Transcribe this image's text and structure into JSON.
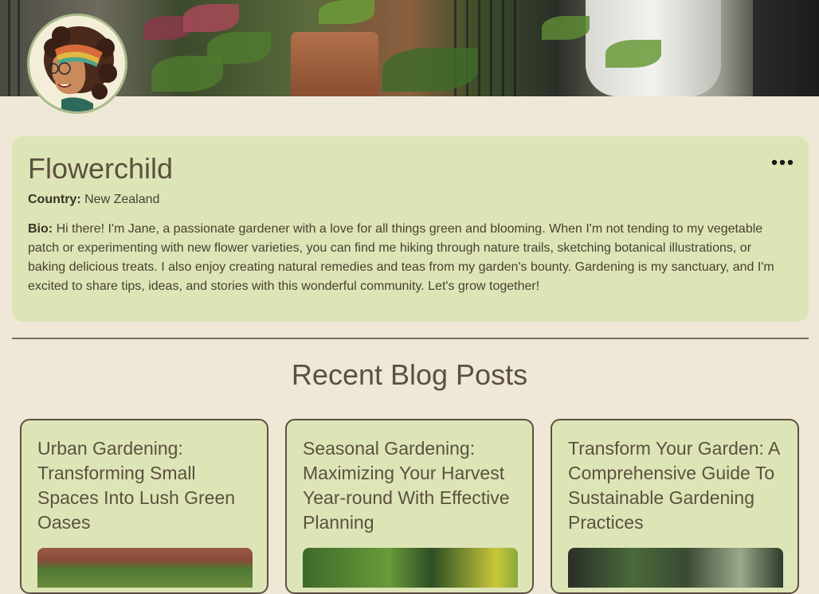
{
  "profile": {
    "username": "Flowerchild",
    "country_label": "Country:",
    "country_value": "New Zealand",
    "bio_label": "Bio:",
    "bio_text": "Hi there! I'm Jane, a passionate gardener with a love for all things green and blooming. When I'm not tending to my vegetable patch or experimenting with new flower varieties, you can find me hiking through nature trails, sketching botanical illustrations, or baking delicious treats. I also enjoy creating natural remedies and teas from my garden's bounty. Gardening is my sanctuary, and I'm excited to share tips, ideas, and stories with this wonderful community. Let's grow together!",
    "more_icon": "more-horizontal-icon"
  },
  "blog": {
    "section_title": "Recent Blog Posts",
    "posts": [
      {
        "title": "Urban Gardening: Transforming Small Spaces Into Lush Green Oases"
      },
      {
        "title": "Seasonal Gardening: Maximizing Your Harvest Year-round With Effective Planning"
      },
      {
        "title": "Transform Your Garden: A Comprehensive Guide To Sustainable Gardening Practices"
      }
    ]
  },
  "colors": {
    "page_background": "#efe8d6",
    "card_background": "#dde5b6",
    "text": "#5c5040",
    "border": "#5c5040"
  }
}
